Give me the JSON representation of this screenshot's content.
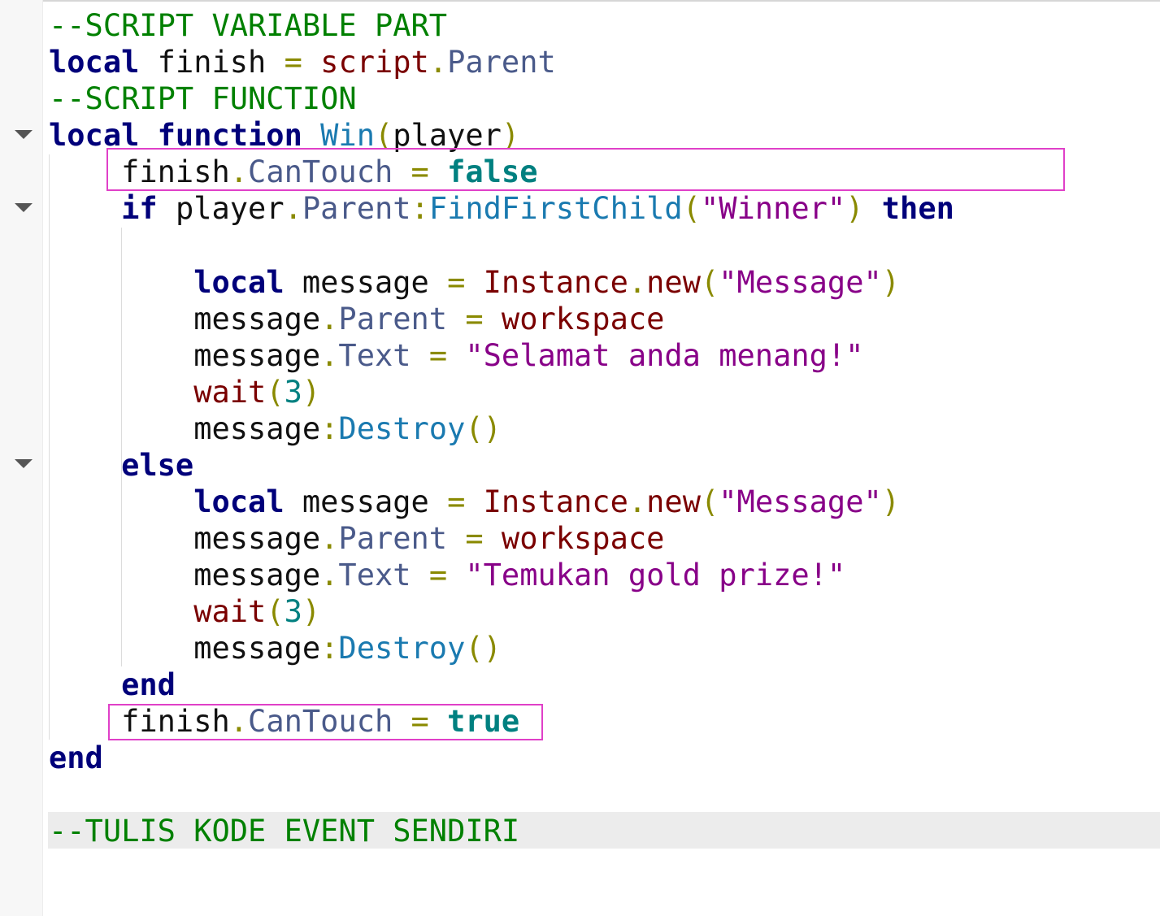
{
  "editor": {
    "lines": [
      {
        "fold": false,
        "tokens": [
          {
            "c": "cm",
            "t": "--SCRIPT VARIABLE PART"
          }
        ]
      },
      {
        "fold": false,
        "tokens": [
          {
            "c": "kw",
            "t": "local"
          },
          {
            "c": "id",
            "t": " finish "
          },
          {
            "c": "op",
            "t": "="
          },
          {
            "c": "id",
            "t": " "
          },
          {
            "c": "bi",
            "t": "script"
          },
          {
            "c": "op",
            "t": "."
          },
          {
            "c": "pr",
            "t": "Parent"
          }
        ]
      },
      {
        "fold": false,
        "tokens": [
          {
            "c": "cm",
            "t": "--SCRIPT FUNCTION"
          }
        ]
      },
      {
        "fold": true,
        "tokens": [
          {
            "c": "kw",
            "t": "local function"
          },
          {
            "c": "id",
            "t": " "
          },
          {
            "c": "fn",
            "t": "Win"
          },
          {
            "c": "op",
            "t": "("
          },
          {
            "c": "id",
            "t": "player"
          },
          {
            "c": "op",
            "t": ")"
          }
        ]
      },
      {
        "fold": false,
        "tokens": [
          {
            "c": "id",
            "t": "    finish"
          },
          {
            "c": "op",
            "t": "."
          },
          {
            "c": "pr",
            "t": "CanTouch"
          },
          {
            "c": "id",
            "t": " "
          },
          {
            "c": "op",
            "t": "="
          },
          {
            "c": "id",
            "t": " "
          },
          {
            "c": "bo",
            "t": "false"
          }
        ]
      },
      {
        "fold": true,
        "tokens": [
          {
            "c": "id",
            "t": "    "
          },
          {
            "c": "kw",
            "t": "if"
          },
          {
            "c": "id",
            "t": " player"
          },
          {
            "c": "op",
            "t": "."
          },
          {
            "c": "pr",
            "t": "Parent"
          },
          {
            "c": "op",
            "t": ":"
          },
          {
            "c": "fn",
            "t": "FindFirstChild"
          },
          {
            "c": "op",
            "t": "("
          },
          {
            "c": "st",
            "t": "\"Winner\""
          },
          {
            "c": "op",
            "t": ")"
          },
          {
            "c": "id",
            "t": " "
          },
          {
            "c": "kw",
            "t": "then"
          }
        ]
      },
      {
        "fold": false,
        "tokens": []
      },
      {
        "fold": false,
        "tokens": [
          {
            "c": "id",
            "t": "        "
          },
          {
            "c": "kw",
            "t": "local"
          },
          {
            "c": "id",
            "t": " message "
          },
          {
            "c": "op",
            "t": "="
          },
          {
            "c": "id",
            "t": " "
          },
          {
            "c": "bi",
            "t": "Instance"
          },
          {
            "c": "op",
            "t": "."
          },
          {
            "c": "bi",
            "t": "new"
          },
          {
            "c": "op",
            "t": "("
          },
          {
            "c": "st",
            "t": "\"Message\""
          },
          {
            "c": "op",
            "t": ")"
          }
        ]
      },
      {
        "fold": false,
        "tokens": [
          {
            "c": "id",
            "t": "        message"
          },
          {
            "c": "op",
            "t": "."
          },
          {
            "c": "pr",
            "t": "Parent"
          },
          {
            "c": "id",
            "t": " "
          },
          {
            "c": "op",
            "t": "="
          },
          {
            "c": "id",
            "t": " "
          },
          {
            "c": "bi",
            "t": "workspace"
          }
        ]
      },
      {
        "fold": false,
        "tokens": [
          {
            "c": "id",
            "t": "        message"
          },
          {
            "c": "op",
            "t": "."
          },
          {
            "c": "pr",
            "t": "Text"
          },
          {
            "c": "id",
            "t": " "
          },
          {
            "c": "op",
            "t": "="
          },
          {
            "c": "id",
            "t": " "
          },
          {
            "c": "st",
            "t": "\"Selamat anda menang!\""
          }
        ]
      },
      {
        "fold": false,
        "tokens": [
          {
            "c": "id",
            "t": "        "
          },
          {
            "c": "bi",
            "t": "wait"
          },
          {
            "c": "op",
            "t": "("
          },
          {
            "c": "nm",
            "t": "3"
          },
          {
            "c": "op",
            "t": ")"
          }
        ]
      },
      {
        "fold": false,
        "tokens": [
          {
            "c": "id",
            "t": "        message"
          },
          {
            "c": "op",
            "t": ":"
          },
          {
            "c": "fn",
            "t": "Destroy"
          },
          {
            "c": "op",
            "t": "()"
          }
        ]
      },
      {
        "fold": true,
        "tokens": [
          {
            "c": "id",
            "t": "    "
          },
          {
            "c": "kw",
            "t": "else"
          }
        ]
      },
      {
        "fold": false,
        "tokens": [
          {
            "c": "id",
            "t": "        "
          },
          {
            "c": "kw",
            "t": "local"
          },
          {
            "c": "id",
            "t": " message "
          },
          {
            "c": "op",
            "t": "="
          },
          {
            "c": "id",
            "t": " "
          },
          {
            "c": "bi",
            "t": "Instance"
          },
          {
            "c": "op",
            "t": "."
          },
          {
            "c": "bi",
            "t": "new"
          },
          {
            "c": "op",
            "t": "("
          },
          {
            "c": "st",
            "t": "\"Message\""
          },
          {
            "c": "op",
            "t": ")"
          }
        ]
      },
      {
        "fold": false,
        "tokens": [
          {
            "c": "id",
            "t": "        message"
          },
          {
            "c": "op",
            "t": "."
          },
          {
            "c": "pr",
            "t": "Parent"
          },
          {
            "c": "id",
            "t": " "
          },
          {
            "c": "op",
            "t": "="
          },
          {
            "c": "id",
            "t": " "
          },
          {
            "c": "bi",
            "t": "workspace"
          }
        ]
      },
      {
        "fold": false,
        "tokens": [
          {
            "c": "id",
            "t": "        message"
          },
          {
            "c": "op",
            "t": "."
          },
          {
            "c": "pr",
            "t": "Text"
          },
          {
            "c": "id",
            "t": " "
          },
          {
            "c": "op",
            "t": "="
          },
          {
            "c": "id",
            "t": " "
          },
          {
            "c": "st",
            "t": "\"Temukan gold prize!\""
          }
        ]
      },
      {
        "fold": false,
        "tokens": [
          {
            "c": "id",
            "t": "        "
          },
          {
            "c": "bi",
            "t": "wait"
          },
          {
            "c": "op",
            "t": "("
          },
          {
            "c": "nm",
            "t": "3"
          },
          {
            "c": "op",
            "t": ")"
          }
        ]
      },
      {
        "fold": false,
        "tokens": [
          {
            "c": "id",
            "t": "        message"
          },
          {
            "c": "op",
            "t": ":"
          },
          {
            "c": "fn",
            "t": "Destroy"
          },
          {
            "c": "op",
            "t": "()"
          }
        ]
      },
      {
        "fold": false,
        "tokens": [
          {
            "c": "id",
            "t": "    "
          },
          {
            "c": "kw",
            "t": "end"
          }
        ]
      },
      {
        "fold": false,
        "tokens": [
          {
            "c": "id",
            "t": "    finish"
          },
          {
            "c": "op",
            "t": "."
          },
          {
            "c": "pr",
            "t": "CanTouch"
          },
          {
            "c": "id",
            "t": " "
          },
          {
            "c": "op",
            "t": "="
          },
          {
            "c": "id",
            "t": " "
          },
          {
            "c": "bo",
            "t": "true"
          }
        ]
      },
      {
        "fold": false,
        "tokens": [
          {
            "c": "kw",
            "t": "end"
          }
        ]
      },
      {
        "fold": false,
        "tokens": []
      },
      {
        "fold": false,
        "tokens": [
          {
            "c": "cm",
            "t": "--TULIS KODE EVENT SENDIRI"
          }
        ]
      }
    ],
    "current_line": 23,
    "highlighted_lines": [
      5,
      20
    ],
    "highlight_color": "#e040c8",
    "colors": {
      "keyword": "#00007a",
      "comment": "#008000",
      "builtin": "#7a0000",
      "property": "#4a5a8a",
      "function": "#1a7ab0",
      "operator": "#8a8a00",
      "string": "#880088",
      "number": "#008080",
      "boolean": "#008080",
      "background": "#ffffff",
      "current_line_bg": "#ececec"
    }
  }
}
